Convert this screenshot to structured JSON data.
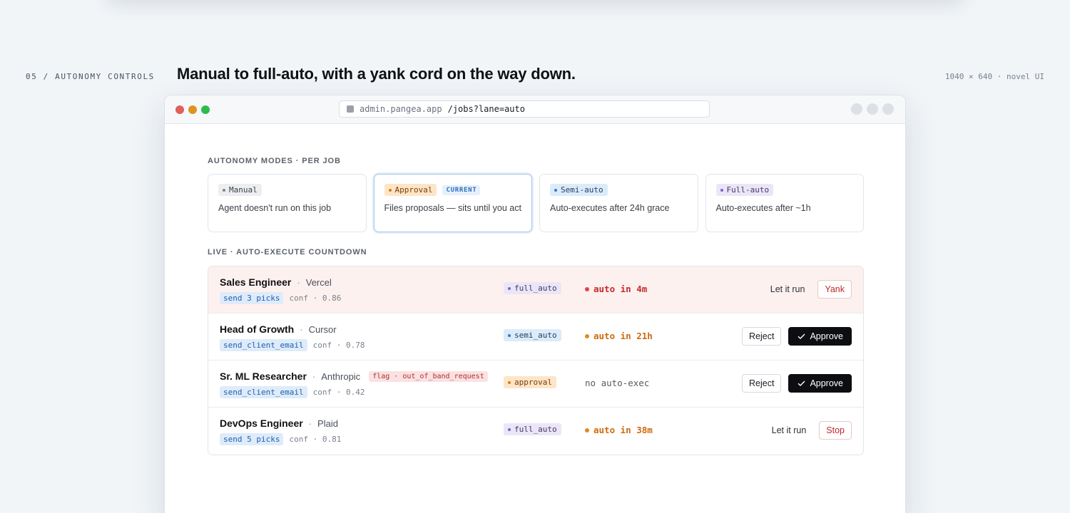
{
  "page": {
    "section_label": "05 / AUTONOMY CONTROLS",
    "headline": "Manual to full-auto, with a yank cord on the way down.",
    "meta_note": "1040 × 640 · novel UI"
  },
  "browser": {
    "url_host": "admin.pangea.app",
    "url_path": "/jobs?lane=auto"
  },
  "modes": {
    "label": "AUTONOMY MODES · PER JOB",
    "items": [
      {
        "name": "Manual",
        "description": "Agent doesn't run on this job",
        "current": false
      },
      {
        "name": "Approval",
        "description": "Files proposals — sits until you act",
        "current": true,
        "current_label": "CURRENT"
      },
      {
        "name": "Semi-auto",
        "description": "Auto-executes after 24h grace",
        "current": false
      },
      {
        "name": "Full-auto",
        "description": "Auto-executes after ~1h",
        "current": false
      }
    ]
  },
  "live": {
    "label": "LIVE · AUTO-EXECUTE COUNTDOWN",
    "jobs": [
      {
        "title": "Sales Engineer",
        "sep": "·",
        "company": "Vercel",
        "action": "send 3 picks",
        "conf": "conf · 0.86",
        "mode": "full_auto",
        "countdown": "auto in 4m",
        "secondary": "Let it run",
        "primary": "Yank"
      },
      {
        "title": "Head of Growth",
        "sep": "·",
        "company": "Cursor",
        "action": "send_client_email",
        "conf": "conf · 0.78",
        "mode": "semi_auto",
        "countdown": "auto in 21h",
        "secondary": "Reject",
        "primary": "Approve"
      },
      {
        "title": "Sr. ML Researcher",
        "sep": "·",
        "company": "Anthropic",
        "flag": "flag · out_of_band_request",
        "action": "send_client_email",
        "conf": "conf · 0.42",
        "mode": "approval",
        "countdown": "no auto-exec",
        "secondary": "Reject",
        "primary": "Approve"
      },
      {
        "title": "DevOps Engineer",
        "sep": "·",
        "company": "Plaid",
        "action": "send 5 picks",
        "conf": "conf · 0.81",
        "mode": "full_auto",
        "countdown": "auto in 38m",
        "secondary": "Let it run",
        "primary": "Stop"
      }
    ]
  },
  "colors": {
    "alert_row_bg": "#fdf1ef",
    "primary_button": "#0d0e11",
    "danger_text": "#c0282a",
    "countdown_urgent": "#c42b2b",
    "countdown_pending": "#cf6a0d"
  },
  "icons": {
    "approve": "check-icon",
    "browser_lock": "lock-icon"
  }
}
